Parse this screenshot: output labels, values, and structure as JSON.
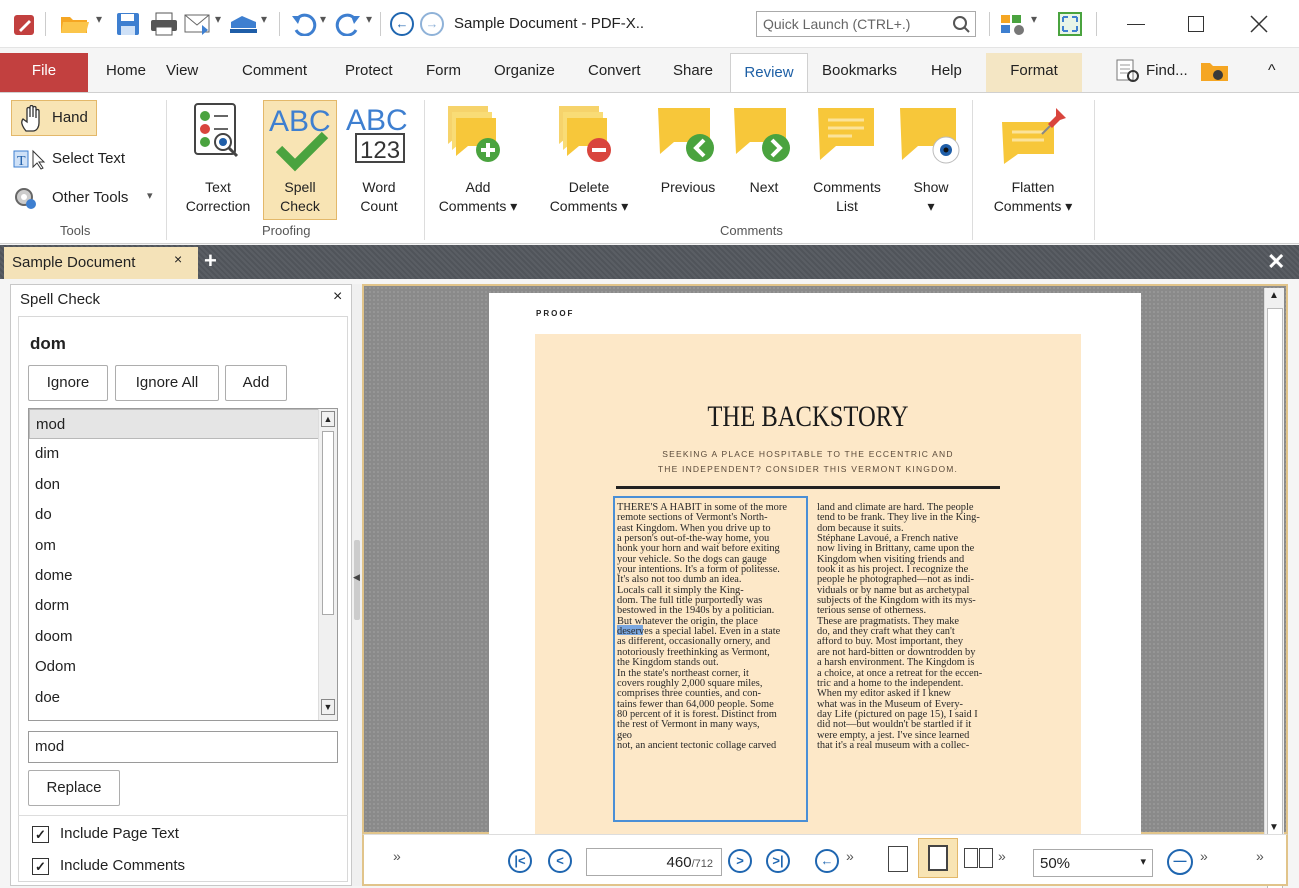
{
  "window": {
    "title": "Sample Document - PDF-X..",
    "quick_launch_placeholder": "Quick Launch (CTRL+.)"
  },
  "menu": {
    "file": "File",
    "items": [
      "Home",
      "View",
      "Comment",
      "Protect",
      "Form",
      "Organize",
      "Convert",
      "Share",
      "Review",
      "Bookmarks",
      "Help",
      "Format"
    ],
    "find": "Find..."
  },
  "ribbon": {
    "tools": {
      "hand": "Hand",
      "select_text": "Select Text",
      "other_tools": "Other Tools",
      "group": "Tools"
    },
    "proofing": {
      "text_correction": [
        "Text",
        "Correction"
      ],
      "spell_check": [
        "Spell",
        "Check"
      ],
      "word_count": [
        "Word",
        "Count"
      ],
      "group": "Proofing"
    },
    "comments": {
      "add": [
        "Add",
        "Comments"
      ],
      "delete": [
        "Delete",
        "Comments"
      ],
      "previous": "Previous",
      "next": "Next",
      "list": [
        "Comments",
        "List"
      ],
      "show": "Show",
      "group": "Comments"
    },
    "flatten": [
      "Flatten",
      "Comments"
    ]
  },
  "doc_tab": {
    "label": "Sample Document"
  },
  "spell_check": {
    "title": "Spell Check",
    "word": "dom",
    "ignore": "Ignore",
    "ignore_all": "Ignore All",
    "add": "Add",
    "suggestions": [
      "mod",
      "dim",
      "don",
      "do",
      "om",
      "dome",
      "dorm",
      "doom",
      "Odom",
      "doe"
    ],
    "replace_value": "mod",
    "replace": "Replace",
    "include_page_text": "Include Page Text",
    "include_comments": "Include Comments"
  },
  "page": {
    "proof": "PROOF",
    "headline": "THE BACKSTORY",
    "subhead": [
      "SEEKING A PLACE HOSPITABLE TO THE ECCENTRIC AND",
      "THE INDEPENDENT? CONSIDER THIS VERMONT KINGDOM."
    ],
    "col1": [
      "THERE'S A HABIT in some of the more",
      "remote sections of Vermont's North-",
      "east Kingdom. When you drive up to",
      "a person's out-of-the-way home, you",
      "honk your horn and wait before exiting",
      "your vehicle. So the dogs can gauge",
      "your intentions. It's a form of politesse.",
      "It's also not too dumb an idea.",
      "Locals call it simply the King-",
      "dom. The full title purportedly was",
      "bestowed in the 1940s by a politician.",
      "But whatever the origin, the place",
      "deserves a special label. Even in a state",
      "as different, occasionally ornery, and",
      "notoriously freethinking as Vermont,",
      "the Kingdom stands out.",
      "In the state's northeast corner, it",
      "covers roughly 2,000 square miles,",
      "comprises three counties, and con-",
      "tains fewer than 64,000 people. Some",
      "80 percent of it is forest. Distinct from",
      "the rest of Vermont in many ways,",
      "geo",
      "not, an ancient tectonic collage carved"
    ],
    "col2": [
      "land and climate are hard. The people",
      "tend to be frank. They live in the King-",
      "dom because it suits.",
      "Stéphane Lavoué, a French native",
      "now living in Brittany, came upon the",
      "Kingdom when visiting friends and",
      "took it as his project. I recognize the",
      "people he photographed—not as indi-",
      "viduals or by name but as archetypal",
      "subjects of the Kingdom with its mys-",
      "terious sense of otherness.",
      "These are pragmatists. They make",
      "do, and they craft what they can't",
      "afford to buy. Most important, they",
      "are not hard-bitten or downtrodden by",
      "a harsh environment. The Kingdom is",
      "a choice, at once a retreat for the eccen-",
      "tric and a home to the independent.",
      "When my editor asked if I knew",
      "what was in the Museum of Every-",
      "day Life (pictured on page 15), I said I",
      "did not—but wouldn't be startled if it",
      "were empty, a jest. I've since learned",
      "that it's a real museum with a collec-"
    ]
  },
  "status": {
    "page_current": "460",
    "page_total": "/712",
    "zoom": "50%"
  },
  "colors": {
    "accent_red": "#c2403f",
    "review_blue": "#1d5fa5",
    "format_tab": "#f4e6c4",
    "article_bg": "#fde8c8",
    "nav_blue": "#1f66b0"
  }
}
